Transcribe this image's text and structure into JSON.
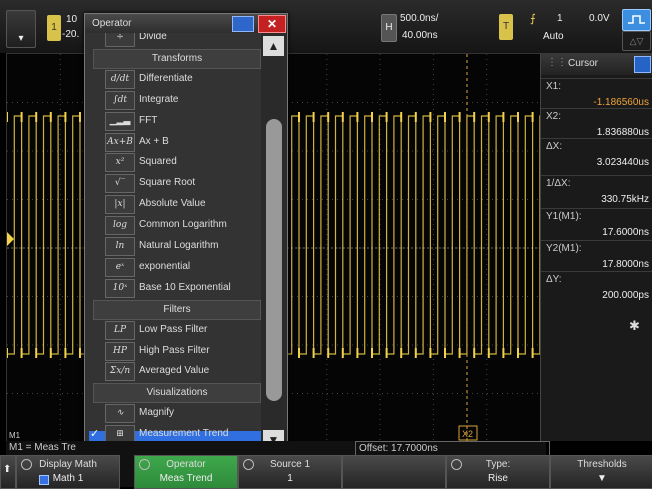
{
  "top_bar": {
    "ch1_number": "1",
    "ch1_scale": "10",
    "ch1_offset": "-20.",
    "horizontal_tile": "H",
    "time_per_div": "500.0ns/",
    "delay": "40.00ns",
    "trigger_tile": "T",
    "trigger_source": "1",
    "trigger_level": "0.0V",
    "trigger_mode": "Auto"
  },
  "operator_menu": {
    "title": "Operator",
    "items": [
      {
        "type": "item",
        "icon": "÷",
        "label": "Divide"
      },
      {
        "type": "header",
        "label": "Transforms"
      },
      {
        "type": "item",
        "icon": "d/dt",
        "label": "Differentiate"
      },
      {
        "type": "item",
        "icon": "∫dt",
        "label": "Integrate"
      },
      {
        "type": "item",
        "icon": "▁▂▃",
        "label": "FFT"
      },
      {
        "type": "item",
        "icon": "Ax+B",
        "label": "Ax + B"
      },
      {
        "type": "item",
        "icon": "x²",
        "label": "Squared"
      },
      {
        "type": "item",
        "icon": "√‾",
        "label": "Square Root"
      },
      {
        "type": "item",
        "icon": "|x|",
        "label": "Absolute Value"
      },
      {
        "type": "item",
        "icon": "log",
        "label": "Common Logarithm"
      },
      {
        "type": "item",
        "icon": "ln",
        "label": "Natural Logarithm"
      },
      {
        "type": "item",
        "icon": "eˣ",
        "label": "exponential"
      },
      {
        "type": "item",
        "icon": "10ˣ",
        "label": "Base 10 Exponential"
      },
      {
        "type": "header",
        "label": "Filters"
      },
      {
        "type": "item",
        "icon": "LP",
        "label": "Low Pass Filter"
      },
      {
        "type": "item",
        "icon": "HP",
        "label": "High Pass Filter"
      },
      {
        "type": "item",
        "icon": "Σx/n",
        "label": "Averaged Value"
      },
      {
        "type": "header",
        "label": "Visualizations"
      },
      {
        "type": "item",
        "icon": "∿",
        "label": "Magnify"
      },
      {
        "type": "item",
        "icon": "⊞",
        "label": "Measurement Trend",
        "selected": true
      }
    ]
  },
  "cursor_panel": {
    "title": "Cursor",
    "rows": [
      {
        "label": "X1:",
        "value": "-1.186560us",
        "value_color": "#f0a43a"
      },
      {
        "label": "X2:",
        "value": "1.836880us",
        "value_color": "#eeeeee"
      },
      {
        "label": "ΔX:",
        "value": "3.023440us",
        "value_color": "#eeeeee"
      },
      {
        "label": "1/ΔX:",
        "value": "330.75kHz",
        "value_color": "#eeeeee"
      },
      {
        "label": "Y1(M1):",
        "value": "17.6000ns",
        "value_color": "#eeeeee"
      },
      {
        "label": "Y2(M1):",
        "value": "17.8000ns",
        "value_color": "#eeeeee"
      },
      {
        "label": "ΔY:",
        "value": "200.000ps",
        "value_color": "#eeeeee"
      }
    ]
  },
  "graticule": {
    "marker_x2": "X2",
    "marker_m1": "M1"
  },
  "status_line": {
    "math_label": "M1 = Meas Tre",
    "offset": "Offset: 17.7000ns"
  },
  "softkeys": [
    {
      "top": "Display Math",
      "bottom": "Math 1",
      "style": "gray",
      "knob": true
    },
    {
      "top": "Operator",
      "bottom": "Meas Trend",
      "style": "green",
      "knob": true
    },
    {
      "top": "Source 1",
      "bottom": "1",
      "style": "gray",
      "knob": true
    },
    {
      "top": "",
      "bottom": "",
      "style": "gray",
      "knob": false
    },
    {
      "top": "Type:",
      "bottom": "Rise",
      "style": "gray",
      "knob": true
    },
    {
      "top": "Thresholds",
      "bottom": "▼",
      "style": "gray",
      "knob": false
    }
  ],
  "colors": {
    "trace": "#f2d24b",
    "selection": "#2f6fe0",
    "softkey_active": "#2e8a3a",
    "close_button": "#c42222"
  }
}
